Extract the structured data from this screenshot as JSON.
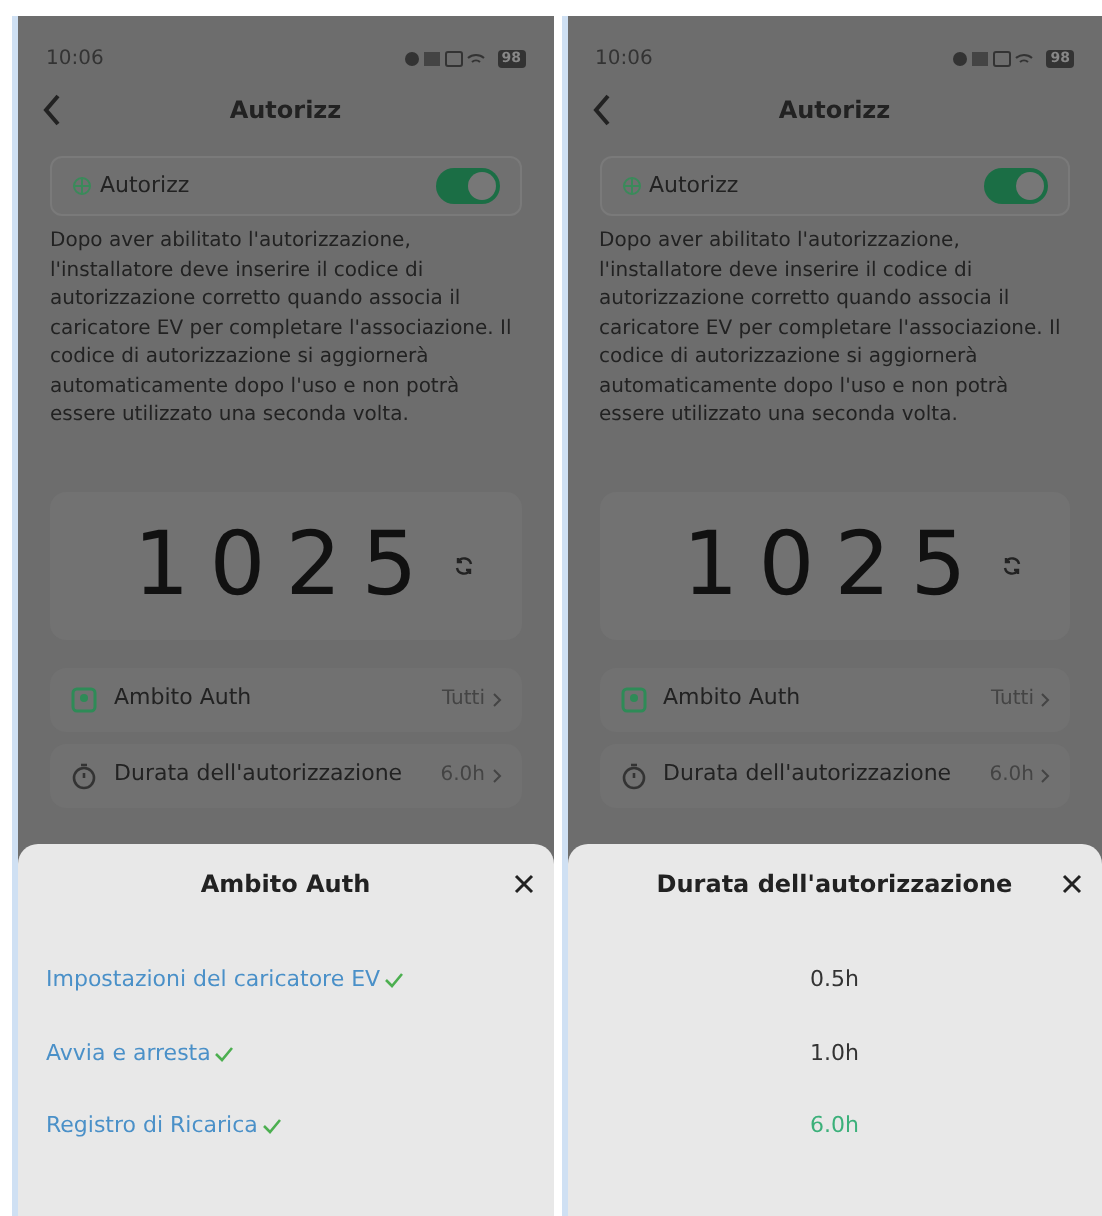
{
  "screens": [
    {
      "status_bar": {
        "time": "10:06",
        "battery": "98"
      },
      "header": {
        "title": "Autorizz"
      },
      "toggle": {
        "label": "Autorizz",
        "on": true
      },
      "description": "Dopo aver abilitato l'autorizzazione, l'installatore deve inserire il codice di autorizzazione corretto quando associa il caricatore EV per completare l'associazione. Il codice di autorizzazione si aggiornerà automaticamente dopo l'uso e non potrà essere utilizzato una seconda volta.",
      "code": "1025",
      "rows": [
        {
          "kind": "scope",
          "label": "Ambito Auth",
          "value": "Tutti"
        },
        {
          "kind": "duration",
          "label": "Durata dell'autorizzazione",
          "value": "6.0h"
        }
      ],
      "sheet": {
        "title": "Ambito Auth",
        "kind": "checklist",
        "items": [
          {
            "label": "Impostazioni del caricatore EV",
            "checked": true
          },
          {
            "label": "Avvia e arresta",
            "checked": true
          },
          {
            "label": "Registro di Ricarica",
            "checked": true
          }
        ]
      }
    },
    {
      "status_bar": {
        "time": "10:06",
        "battery": "98"
      },
      "header": {
        "title": "Autorizz"
      },
      "toggle": {
        "label": "Autorizz",
        "on": true
      },
      "description": "Dopo aver abilitato l'autorizzazione, l'installatore deve inserire il codice di autorizzazione corretto quando associa il caricatore EV per completare l'associazione. Il codice di autorizzazione si aggiornerà automaticamente dopo l'uso e non potrà essere utilizzato una seconda volta.",
      "code": "1025",
      "rows": [
        {
          "kind": "scope",
          "label": "Ambito Auth",
          "value": "Tutti"
        },
        {
          "kind": "duration",
          "label": "Durata dell'autorizzazione",
          "value": "6.0h"
        }
      ],
      "sheet": {
        "title": "Durata dell'autorizzazione",
        "kind": "options",
        "items": [
          {
            "label": "0.5h",
            "selected": false
          },
          {
            "label": "1.0h",
            "selected": false
          },
          {
            "label": "6.0h",
            "selected": true
          }
        ]
      }
    }
  ]
}
